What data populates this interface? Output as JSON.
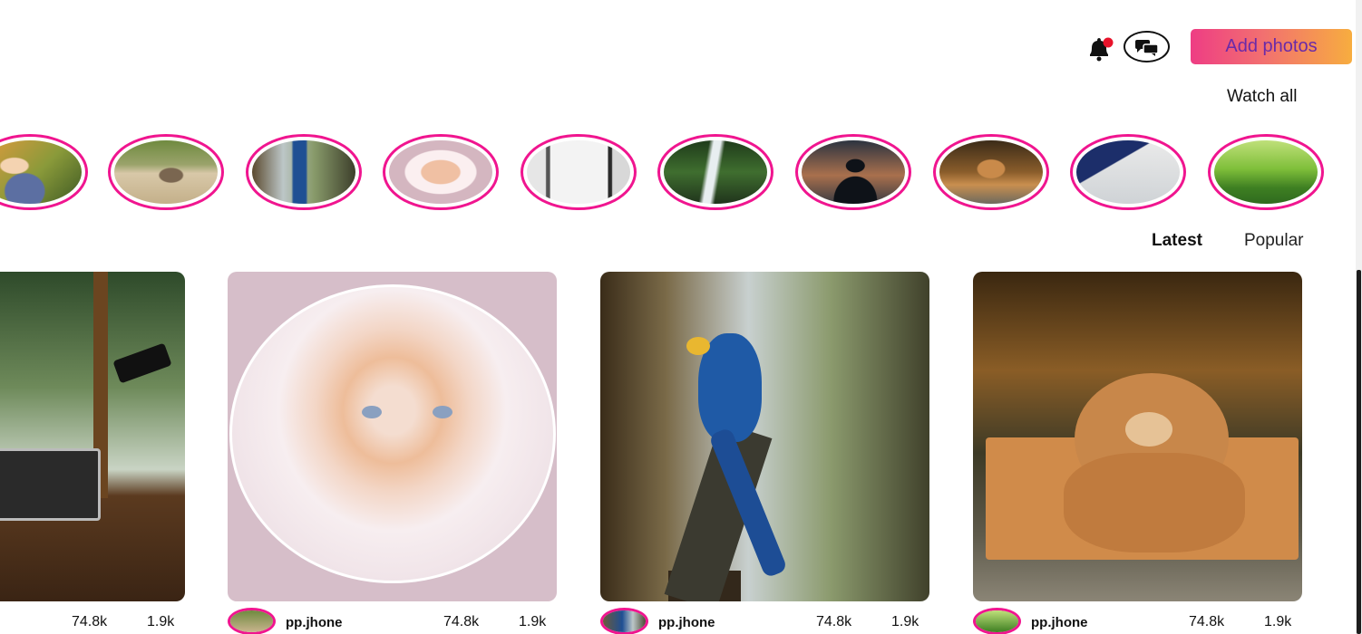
{
  "header": {
    "notifications_icon": "bell-icon",
    "messages_icon": "chat-icon",
    "add_button_label": "Add photos",
    "accent_gradient": [
      "#ee3d84",
      "#f7ad3f"
    ],
    "notification_dot_color": "#e8132b"
  },
  "stories": {
    "watch_all_label": "Watch all",
    "ring_color": "#f0158f",
    "items": [
      {
        "subject": "baby"
      },
      {
        "subject": "chipmunk"
      },
      {
        "subject": "parrot"
      },
      {
        "subject": "kitten"
      },
      {
        "subject": "window-room"
      },
      {
        "subject": "waterfall"
      },
      {
        "subject": "silhouette"
      },
      {
        "subject": "teddy-bear"
      },
      {
        "subject": "laptop-desk"
      },
      {
        "subject": "meadow"
      }
    ]
  },
  "feed": {
    "tabs": [
      {
        "label": "Latest",
        "active": true
      },
      {
        "label": "Popular",
        "active": false
      }
    ],
    "posts": [
      {
        "subject": "desk-laptop-window",
        "user": "",
        "likes": "74.8k",
        "comments": "1.9k"
      },
      {
        "subject": "kitten",
        "user": "pp.jhone",
        "likes": "74.8k",
        "comments": "1.9k"
      },
      {
        "subject": "parrot",
        "user": "pp.jhone",
        "likes": "74.8k",
        "comments": "1.9k"
      },
      {
        "subject": "teddy-bear",
        "user": "pp.jhone",
        "likes": "74.8k",
        "comments": "1.9k"
      }
    ]
  }
}
